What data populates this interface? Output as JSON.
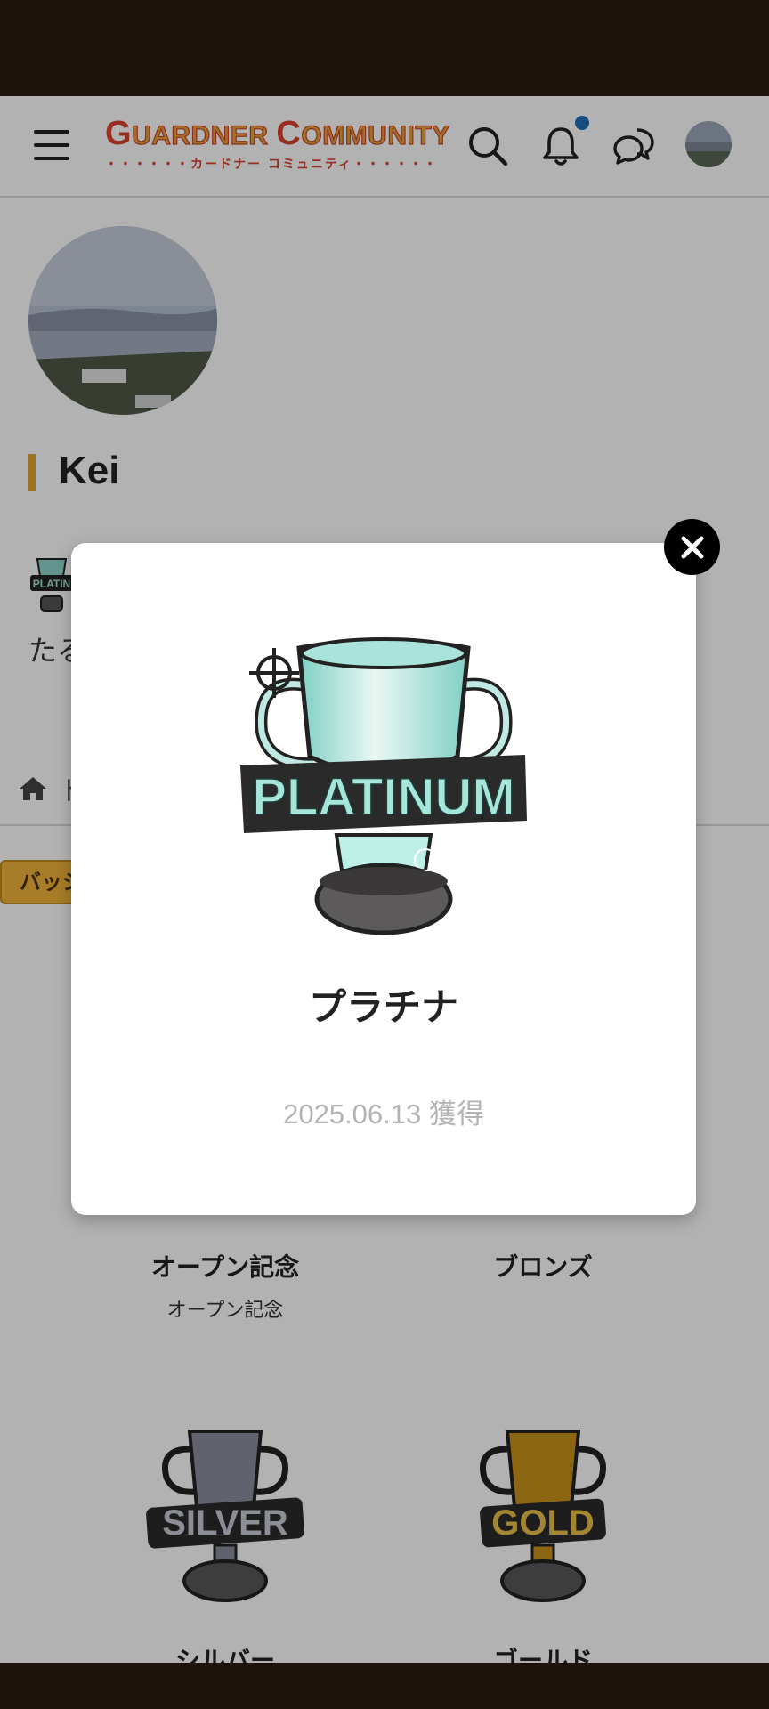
{
  "header": {
    "logo_main_first": "G",
    "logo_main_mid": "UARDNER ",
    "logo_main_second": "C",
    "logo_main_end": "OMMUNITY",
    "logo_sub": "・・・・・・カードナー コミュニティ・・・・・・",
    "icons": [
      "menu-icon",
      "search-icon",
      "bell-icon",
      "chat-icon",
      "avatar"
    ],
    "notification_dot_color": "#1e6fb5"
  },
  "profile": {
    "name": "Kei",
    "bio": "たる",
    "accent_color": "#e0a52e"
  },
  "breadcrumb": {
    "home_text": "ト"
  },
  "tabs": {
    "badges_label": "バッジ"
  },
  "badges": [
    {
      "title": "オープン記念",
      "description": "オープン記念"
    },
    {
      "title": "ブロンズ",
      "description": ""
    },
    {
      "title": "シルバー",
      "trophy_text": "SILVER"
    },
    {
      "title": "ゴールド",
      "trophy_text": "GOLD"
    }
  ],
  "modal": {
    "trophy_text": "PLATINUM",
    "title": "プラチナ",
    "date": "2025.06.13 獲得",
    "mini_badge_text": "PLATIN"
  }
}
